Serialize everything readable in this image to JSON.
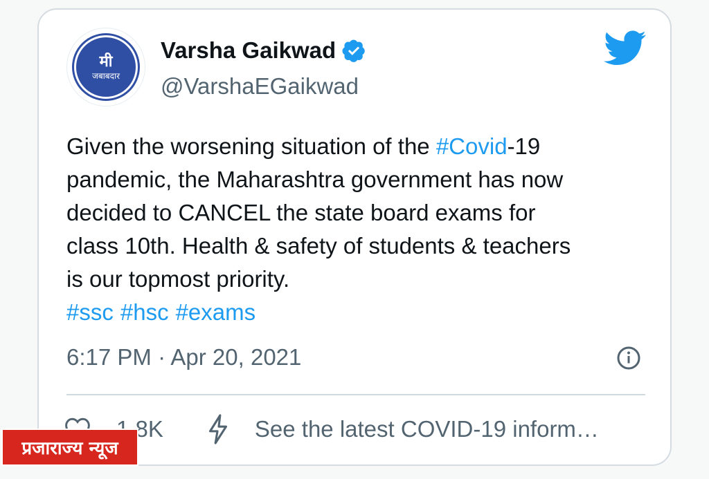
{
  "author": {
    "display_name": "Varsha Gaikwad",
    "handle": "@VarshaEGaikwad",
    "avatar_line1": "मी",
    "avatar_line2": "जबाबदार",
    "verified_icon": "verified-badge-icon"
  },
  "tweet": {
    "text_part1": "Given the worsening situation of the ",
    "hashtag_covid": "#Covid",
    "text_part2": "-19\npandemic, the Maharashtra government has now\ndecided to CANCEL the state board exams for\nclass 10th. Health & safety of students & teachers\nis our topmost priority.",
    "hashtags": [
      "#ssc",
      "#hsc",
      "#exams"
    ],
    "timestamp": "6:17 PM · Apr 20, 2021"
  },
  "actions": {
    "like_count": "1.8K",
    "covid_info": "See the latest COVID-19 inform…"
  },
  "watermark": {
    "text": "प्रजाराज्य न्यूज"
  },
  "colors": {
    "link": "#1d9bf0",
    "secondary_text": "#536471",
    "watermark_bg": "#d7261e",
    "avatar_bg": "#2f4fa5"
  }
}
